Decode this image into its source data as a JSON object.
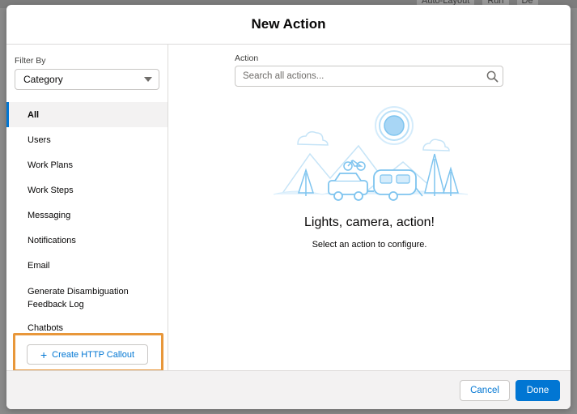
{
  "background_app": {
    "toolbar_items": [
      "Auto-Layout",
      "Run",
      "De"
    ]
  },
  "modal": {
    "title": "New Action"
  },
  "sidebar": {
    "filter_label": "Filter By",
    "filter_value": "Category",
    "categories": [
      {
        "label": "All",
        "active": true
      },
      {
        "label": "Users"
      },
      {
        "label": "Work Plans"
      },
      {
        "label": "Work Steps"
      },
      {
        "label": "Messaging"
      },
      {
        "label": "Notifications"
      },
      {
        "label": "Email"
      },
      {
        "label": "Generate Disambiguation Feedback Log"
      },
      {
        "label": "Chatbots"
      }
    ],
    "create_button_label": "Create HTTP Callout"
  },
  "main": {
    "action_label": "Action",
    "search_placeholder": "Search all actions...",
    "empty_title": "Lights, camera, action!",
    "empty_subtitle": "Select an action to configure."
  },
  "footer": {
    "cancel_label": "Cancel",
    "done_label": "Done"
  },
  "colors": {
    "brand": "#0176d3",
    "highlight": "#e8973a",
    "illustration_blue": "#7ec4ef"
  }
}
